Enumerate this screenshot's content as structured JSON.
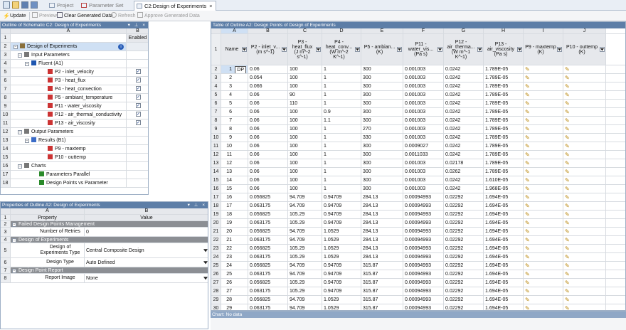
{
  "tabs": [
    {
      "label": "Project",
      "active": false
    },
    {
      "label": "Parameter Set",
      "active": false
    },
    {
      "label": "C2:Design of Experiments",
      "active": true
    }
  ],
  "toolbar": {
    "update": "Update",
    "preview": "Preview",
    "clear": "Clear Generated Data",
    "refresh": "Refresh",
    "approve": "Approve Generated Data"
  },
  "outline": {
    "title": "Outline of Schematic C2: Design of Experiments",
    "col_a": "A",
    "col_b": "B",
    "header_enabled": "Enabled",
    "rows": [
      {
        "n": "1",
        "label": "",
        "enabled": "Enabled"
      },
      {
        "n": "2",
        "label": "Design of Experiments",
        "checked": false
      },
      {
        "n": "3",
        "label": "Input Parameters",
        "checked": false
      },
      {
        "n": "4",
        "label": "Fluent (A1)",
        "checked": false
      },
      {
        "n": "5",
        "label": "P2 - inlet_velocity",
        "checked": true
      },
      {
        "n": "6",
        "label": "P3 - heat_flux",
        "checked": true
      },
      {
        "n": "7",
        "label": "P4 - heat_convection",
        "checked": true
      },
      {
        "n": "8",
        "label": "P5 - ambiant_temperature",
        "checked": true
      },
      {
        "n": "9",
        "label": "P11 - water_viscosity",
        "checked": true
      },
      {
        "n": "10",
        "label": "P12 - air_thermal_conductivity",
        "checked": true
      },
      {
        "n": "11",
        "label": "P13 - air_viscosity",
        "checked": true
      },
      {
        "n": "12",
        "label": "Output Parameters",
        "checked": false
      },
      {
        "n": "13",
        "label": "Results (B1)",
        "checked": false
      },
      {
        "n": "14",
        "label": "P9 - maxtemp",
        "checked": false
      },
      {
        "n": "15",
        "label": "P10 - outtemp",
        "checked": false
      },
      {
        "n": "16",
        "label": "Charts",
        "checked": false
      },
      {
        "n": "17",
        "label": "Parameters Parallel",
        "checked": false
      },
      {
        "n": "18",
        "label": "Design Points vs Parameter",
        "checked": false
      }
    ]
  },
  "properties": {
    "title": "Properties of Outline A2: Design of Experiments",
    "col_a": "A",
    "col_b": "B",
    "h_property": "Property",
    "h_value": "Value",
    "rows": [
      {
        "n": "1",
        "prop": "Property",
        "val": "Value"
      },
      {
        "n": "2",
        "prop": "Failed Design Points Management",
        "val": ""
      },
      {
        "n": "3",
        "prop": "Number of Retries",
        "val": "0"
      },
      {
        "n": "4",
        "prop": "Design of Experiments",
        "val": ""
      },
      {
        "n": "5",
        "prop": "Design of Experiments Type",
        "val": "Central Composite Design"
      },
      {
        "n": "6",
        "prop": "Design Type",
        "val": "Auto Defined"
      },
      {
        "n": "7",
        "prop": "Design Point Report",
        "val": ""
      },
      {
        "n": "8",
        "prop": "Report Image",
        "val": "None"
      }
    ]
  },
  "table": {
    "title": "Table of Outline A2: Design Points of Design of Experiments",
    "cols": [
      "A",
      "B",
      "C",
      "D",
      "E",
      "F",
      "G",
      "H",
      "I",
      "J"
    ],
    "headers": [
      "Name",
      "P2 - inlet_v... (m s^-1)",
      "P3 - heat_flux (J m^-2 s^-1)",
      "P4 - heat_conv... (W m^-2 K^-1)",
      "P5 - ambian... (K)",
      "P11 - water_vis... (Pa s)",
      "P12 - air_therma... (W m^-1 K^-1)",
      "P13 - air_viscosity (Pa s)",
      "P9 - maxtemp (K)",
      "P10 - outtemp (K)"
    ],
    "rows": [
      [
        "1",
        "DP",
        "0.06",
        "100",
        "1",
        "300",
        "0.001003",
        "0.0242",
        "1.789E-05"
      ],
      [
        "2",
        "",
        "0.054",
        "100",
        "1",
        "300",
        "0.001003",
        "0.0242",
        "1.789E-05"
      ],
      [
        "3",
        "",
        "0.066",
        "100",
        "1",
        "300",
        "0.001003",
        "0.0242",
        "1.789E-05"
      ],
      [
        "4",
        "",
        "0.06",
        "90",
        "1",
        "300",
        "0.001003",
        "0.0242",
        "1.789E-05"
      ],
      [
        "5",
        "",
        "0.06",
        "110",
        "1",
        "300",
        "0.001003",
        "0.0242",
        "1.789E-05"
      ],
      [
        "6",
        "",
        "0.06",
        "100",
        "0.9",
        "300",
        "0.001003",
        "0.0242",
        "1.789E-05"
      ],
      [
        "7",
        "",
        "0.06",
        "100",
        "1.1",
        "300",
        "0.001003",
        "0.0242",
        "1.789E-05"
      ],
      [
        "8",
        "",
        "0.06",
        "100",
        "1",
        "270",
        "0.001003",
        "0.0242",
        "1.789E-05"
      ],
      [
        "9",
        "",
        "0.06",
        "100",
        "1",
        "330",
        "0.001003",
        "0.0242",
        "1.789E-05"
      ],
      [
        "10",
        "",
        "0.06",
        "100",
        "1",
        "300",
        "0.0009027",
        "0.0242",
        "1.789E-05"
      ],
      [
        "11",
        "",
        "0.06",
        "100",
        "1",
        "300",
        "0.0011033",
        "0.0242",
        "1.789E-05"
      ],
      [
        "12",
        "",
        "0.06",
        "100",
        "1",
        "300",
        "0.001003",
        "0.02178",
        "1.789E-05"
      ],
      [
        "13",
        "",
        "0.06",
        "100",
        "1",
        "300",
        "0.001003",
        "0.0262",
        "1.789E-05"
      ],
      [
        "14",
        "",
        "0.06",
        "100",
        "1",
        "300",
        "0.001003",
        "0.0242",
        "1.610E-05"
      ],
      [
        "15",
        "",
        "0.06",
        "100",
        "1",
        "300",
        "0.001003",
        "0.0242",
        "1.968E-05"
      ],
      [
        "16",
        "",
        "0.056825",
        "94.709",
        "0.94709",
        "284.13",
        "0.00094993",
        "0.02292",
        "1.694E-05"
      ],
      [
        "17",
        "",
        "0.063175",
        "94.709",
        "0.94709",
        "284.13",
        "0.00094993",
        "0.02292",
        "1.694E-05"
      ],
      [
        "18",
        "",
        "0.056825",
        "105.29",
        "0.94709",
        "284.13",
        "0.00094993",
        "0.02292",
        "1.694E-05"
      ],
      [
        "19",
        "",
        "0.063175",
        "105.29",
        "0.94709",
        "284.13",
        "0.00094993",
        "0.02292",
        "1.694E-05"
      ],
      [
        "20",
        "",
        "0.056825",
        "94.709",
        "1.0529",
        "284.13",
        "0.00094993",
        "0.02292",
        "1.694E-05"
      ],
      [
        "21",
        "",
        "0.063175",
        "94.709",
        "1.0529",
        "284.13",
        "0.00094993",
        "0.02292",
        "1.694E-05"
      ],
      [
        "22",
        "",
        "0.056825",
        "105.29",
        "1.0529",
        "284.13",
        "0.00094993",
        "0.02292",
        "1.694E-05"
      ],
      [
        "23",
        "",
        "0.063175",
        "105.29",
        "1.0529",
        "284.13",
        "0.00094993",
        "0.02292",
        "1.694E-05"
      ],
      [
        "24",
        "",
        "0.056825",
        "94.709",
        "0.94709",
        "315.87",
        "0.00094993",
        "0.02292",
        "1.694E-05"
      ],
      [
        "25",
        "",
        "0.063175",
        "94.709",
        "0.94709",
        "315.87",
        "0.00094993",
        "0.02292",
        "1.694E-05"
      ],
      [
        "26",
        "",
        "0.056825",
        "105.29",
        "0.94709",
        "315.87",
        "0.00094993",
        "0.02292",
        "1.694E-05"
      ],
      [
        "27",
        "",
        "0.063175",
        "105.29",
        "0.94709",
        "315.87",
        "0.00094993",
        "0.02292",
        "1.694E-05"
      ],
      [
        "28",
        "",
        "0.056825",
        "94.709",
        "1.0529",
        "315.87",
        "0.00094993",
        "0.02292",
        "1.694E-05"
      ],
      [
        "29",
        "",
        "0.063175",
        "94.709",
        "1.0529",
        "315.87",
        "0.00094993",
        "0.02292",
        "1.694E-05"
      ]
    ]
  },
  "chart": {
    "title": "Chart: No data"
  },
  "colors": {
    "title_bar": "#5d7ea7",
    "selection": "#cfe0f4",
    "section_gray": "#8c8f94"
  }
}
